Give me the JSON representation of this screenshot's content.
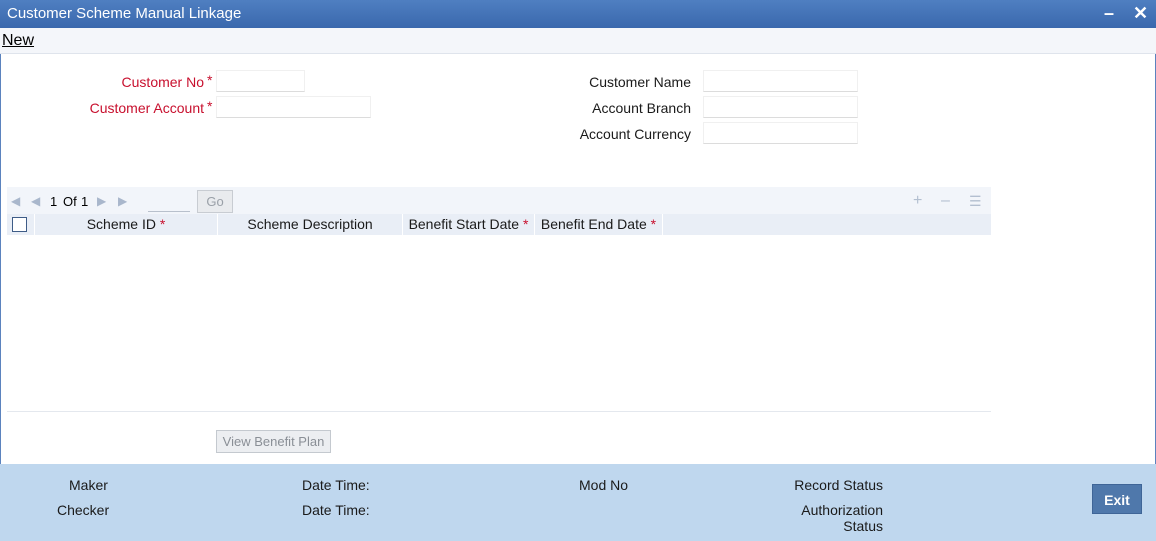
{
  "window": {
    "title": "Customer Scheme Manual Linkage",
    "minimize_icon": "minimize-icon",
    "close_icon": "close-icon"
  },
  "menu": {
    "new_label": "New"
  },
  "form": {
    "customer_no_label": "Customer No",
    "customer_account_label": "Customer Account",
    "required_marker": "*",
    "customer_name_label": "Customer Name",
    "account_branch_label": "Account Branch",
    "account_currency_label": "Account Currency",
    "customer_no_value": "",
    "customer_account_value": "",
    "customer_name_value": "",
    "account_branch_value": "",
    "account_currency_value": ""
  },
  "grid": {
    "page_current": "1",
    "page_of": "Of",
    "page_total": "1",
    "go_label": "Go",
    "columns": [
      {
        "label": "Scheme ID",
        "required": "*"
      },
      {
        "label": "Scheme Description",
        "required": ""
      },
      {
        "label": "Benefit Start Date",
        "required": "*"
      },
      {
        "label": "Benefit End Date",
        "required": "*"
      }
    ],
    "rows": []
  },
  "buttons": {
    "view_benefit_plan": "View Benefit Plan",
    "exit": "Exit"
  },
  "footer": {
    "maker": "Maker",
    "checker": "Checker",
    "date_time_1": "Date Time:",
    "date_time_2": "Date Time:",
    "mod_no": "Mod No",
    "record_status": "Record Status",
    "authorization_status_1": "Authorization",
    "authorization_status_2": "Status"
  },
  "colors": {
    "title_bar": "#3a68ad",
    "required": "#c8102e",
    "footer": "#bfd7ee",
    "exit_button": "#4f78ab"
  }
}
